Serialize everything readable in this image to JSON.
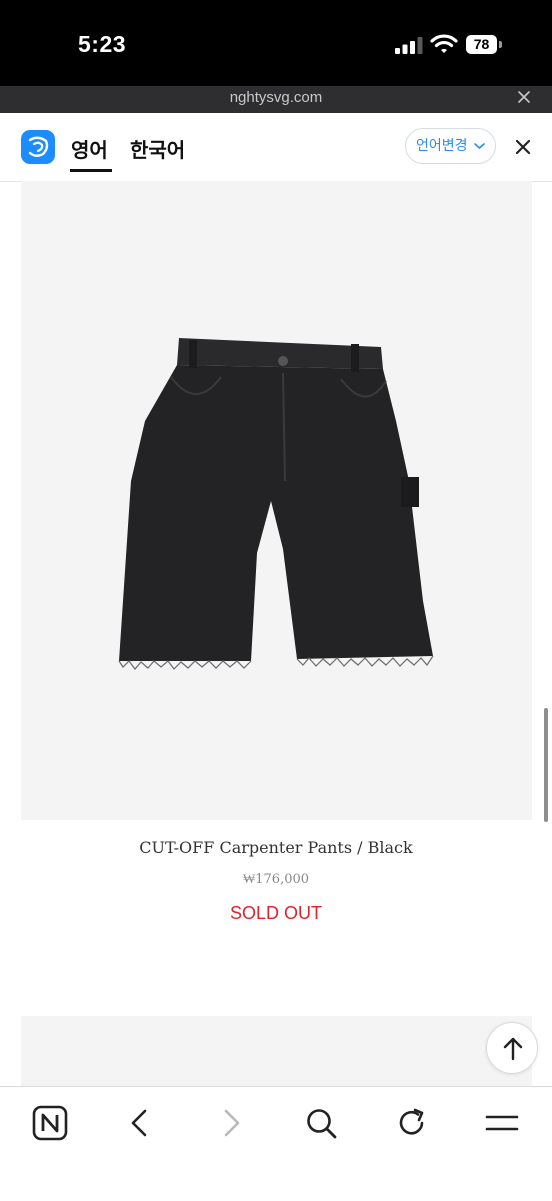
{
  "status_bar": {
    "time": "5:23",
    "battery": "78"
  },
  "url_bar": {
    "url": "nghtysvg.com"
  },
  "translate_bar": {
    "tab_source": "영어",
    "tab_target": "한국어",
    "change_language_label": "언어변경"
  },
  "product": {
    "name": "CUT-OFF Carpenter Pants / Black",
    "price": "₩176,000",
    "status": "SOLD OUT"
  },
  "icons": {
    "status": [
      "signal-icon",
      "wifi-icon",
      "battery-icon"
    ],
    "toolbar": [
      "naver-home-icon",
      "back-icon",
      "forward-icon",
      "search-icon",
      "reload-icon",
      "menu-icon"
    ],
    "other": [
      "translate-logo-icon",
      "close-icon",
      "chevron-down-icon",
      "arrow-up-icon"
    ]
  },
  "colors": {
    "sold_out": "#e4212b",
    "accent": "#2d8cf0",
    "status_bar_bg": "#000000",
    "url_bar_bg": "#2e2e30"
  }
}
